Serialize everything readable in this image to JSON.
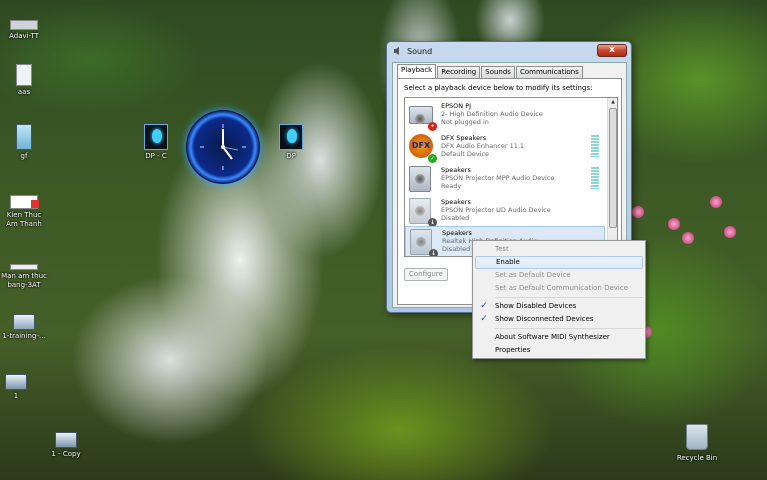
{
  "desktop": {
    "icons": [
      {
        "label": "Adavi-TT"
      },
      {
        "label": "aas"
      },
      {
        "label": "gf"
      },
      {
        "label": "Kien Thuc Am Thanh"
      },
      {
        "label": "Mạn am thuc bang-3AT"
      },
      {
        "label": "1-training-..."
      },
      {
        "label": "1"
      },
      {
        "label": "1 - Copy"
      },
      {
        "label": "DP - C"
      },
      {
        "label": "DP"
      },
      {
        "label": "Recycle Bin"
      }
    ]
  },
  "sound_dialog": {
    "title": "Sound",
    "close_label": "x",
    "tabs": [
      "Playback",
      "Recording",
      "Sounds",
      "Communications"
    ],
    "instruction": "Select a playback device below to modify its settings:",
    "devices": [
      {
        "name": "EPSON PJ",
        "desc": "2- High Definition Audio Device",
        "status": "Not plugged in"
      },
      {
        "name": "DFX Speakers",
        "desc": "DFX Audio Enhancer 11.1",
        "status": "Default Device"
      },
      {
        "name": "Speakers",
        "desc": "EPSON Projector MPP Audio Device",
        "status": "Ready"
      },
      {
        "name": "Speakers",
        "desc": "EPSON Projector UD Audio Device",
        "status": "Disabled"
      },
      {
        "name": "Speakers",
        "desc": "Realtek High Definition Audio",
        "status": "Disabled"
      }
    ],
    "configure_label": "Configure"
  },
  "context_menu": {
    "items": [
      {
        "label": "Test"
      },
      {
        "label": "Enable"
      },
      {
        "label": "Set as Default Device"
      },
      {
        "label": "Set as Default Communication Device"
      },
      {
        "label": "Show Disabled Devices"
      },
      {
        "label": "Show Disconnected Devices"
      },
      {
        "label": "About Software MIDI Synthesizer"
      },
      {
        "label": "Properties"
      }
    ],
    "check_glyph": "✓"
  }
}
